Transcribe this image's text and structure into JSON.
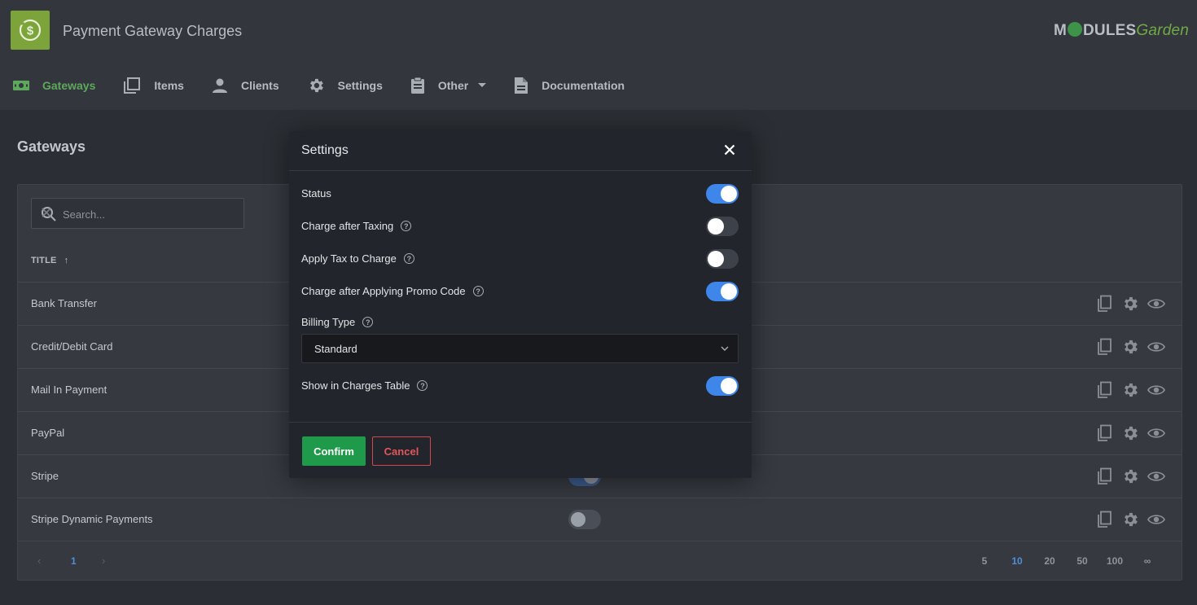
{
  "app": {
    "title": "Payment Gateway Charges",
    "brand_main": "M",
    "brand_rest": "DULES",
    "brand_garden": "Garden"
  },
  "nav": {
    "gateways": "Gateways",
    "items": "Items",
    "clients": "Clients",
    "settings": "Settings",
    "other": "Other",
    "documentation": "Documentation"
  },
  "page": {
    "title": "Gateways",
    "search_placeholder": "Search...",
    "column_title": "TITLE",
    "sort_arrow": "↑"
  },
  "rows": [
    {
      "name": "Bank Transfer"
    },
    {
      "name": "Credit/Debit Card"
    },
    {
      "name": "Mail In Payment"
    },
    {
      "name": "PayPal"
    },
    {
      "name": "Stripe",
      "status_on": true
    },
    {
      "name": "Stripe Dynamic Payments",
      "status_on": false
    }
  ],
  "pagination": {
    "prev": "‹",
    "current": "1",
    "next": "›",
    "sizes": [
      "5",
      "10",
      "20",
      "50",
      "100",
      "∞"
    ],
    "selected_size": "10"
  },
  "modal": {
    "title": "Settings",
    "fields": {
      "status": {
        "label": "Status",
        "on": true
      },
      "charge_after_taxing": {
        "label": "Charge after Taxing",
        "on": false
      },
      "apply_tax": {
        "label": "Apply Tax to Charge",
        "on": false
      },
      "promo": {
        "label": "Charge after Applying Promo Code",
        "on": true
      },
      "billing_type": {
        "label": "Billing Type",
        "value": "Standard"
      },
      "charges_table": {
        "label": "Show in Charges Table",
        "on": true
      }
    },
    "confirm": "Confirm",
    "cancel": "Cancel"
  },
  "colors": {
    "accent_green": "#5ea85c",
    "toggle_on": "#3f86ea",
    "confirm": "#1f9a4a",
    "cancel": "#e0575b"
  }
}
